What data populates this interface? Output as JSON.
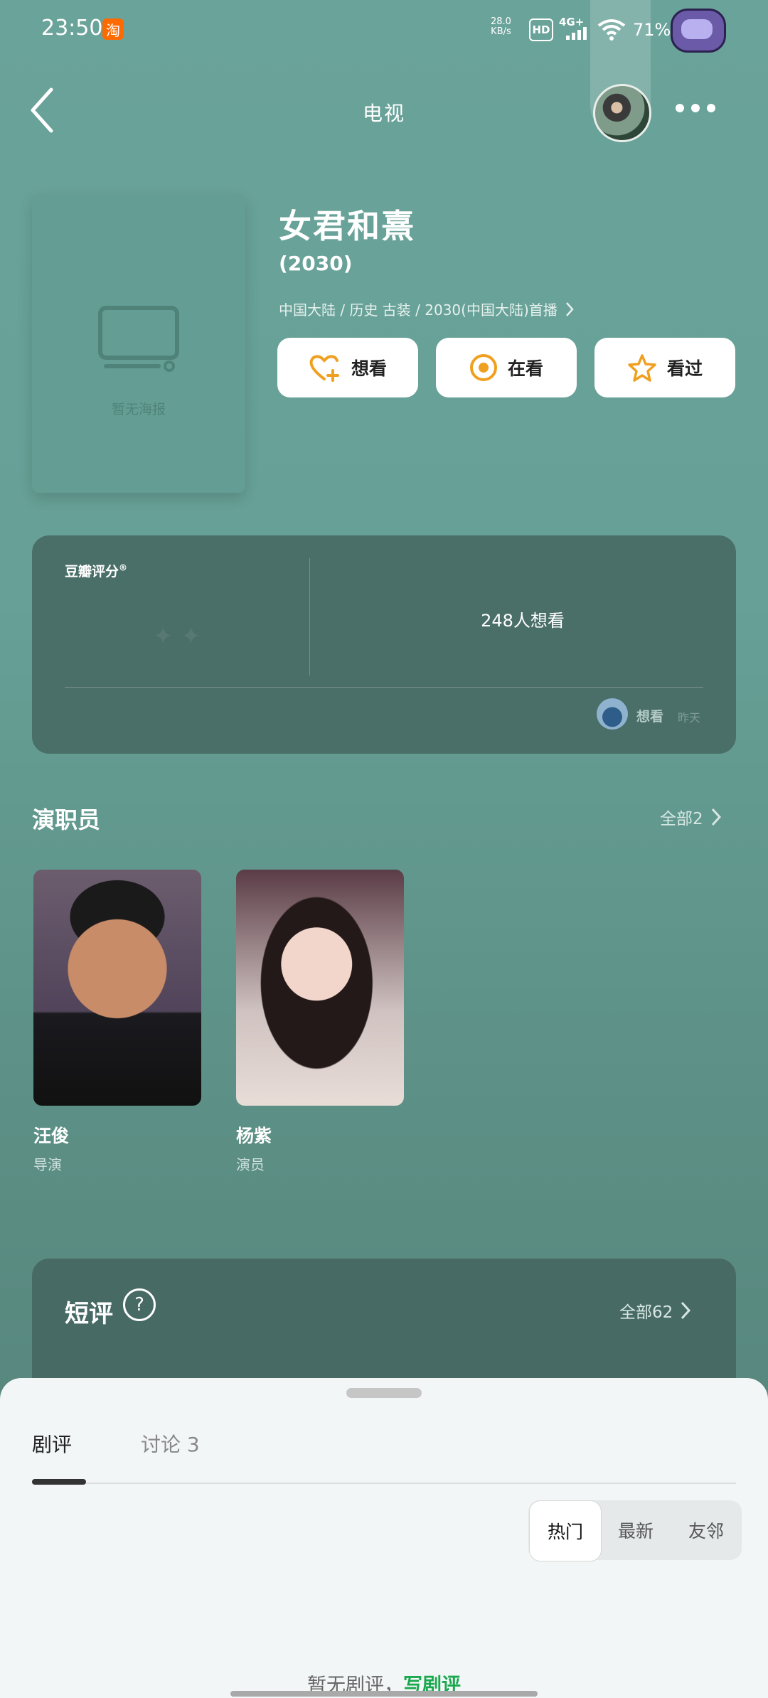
{
  "status_bar": {
    "time": "23:50",
    "app_badge": "淘",
    "net_speed_value": "28.0",
    "net_speed_unit": "KB/s",
    "hd": "HD",
    "network": "4G+",
    "battery": "71%"
  },
  "header": {
    "title": "电视"
  },
  "poster": {
    "placeholder_text": "暂无海报"
  },
  "show": {
    "title": "女君和熹",
    "year": "(2030)",
    "meta": "中国大陆 / 历史 古装 / 2030(中国大陆)首播"
  },
  "actions": [
    {
      "label": "想看",
      "icon": "heart-plus-icon"
    },
    {
      "label": "在看",
      "icon": "target-icon"
    },
    {
      "label": "看过",
      "icon": "star-icon"
    }
  ],
  "rating": {
    "label": "豆瓣评分",
    "label_sup": "®",
    "want_count": "248人想看",
    "friend_action": "想看",
    "friend_time": "昨天"
  },
  "cast": {
    "title": "演职员",
    "more": "全部2",
    "members": [
      {
        "name": "汪俊",
        "role": "导演"
      },
      {
        "name": "杨紫",
        "role": "演员"
      }
    ]
  },
  "short_reviews": {
    "title": "短评",
    "help": "?",
    "more": "全部62"
  },
  "sheet": {
    "tabs": [
      "剧评",
      "讨论 3"
    ],
    "sort_options": [
      "热门",
      "最新",
      "友邻"
    ],
    "empty_text": "暂无剧评，",
    "write_link": "写剧评"
  },
  "colors": {
    "background": "#66a096",
    "accent_orange": "#f0a020",
    "link_green": "#1aa84f"
  }
}
